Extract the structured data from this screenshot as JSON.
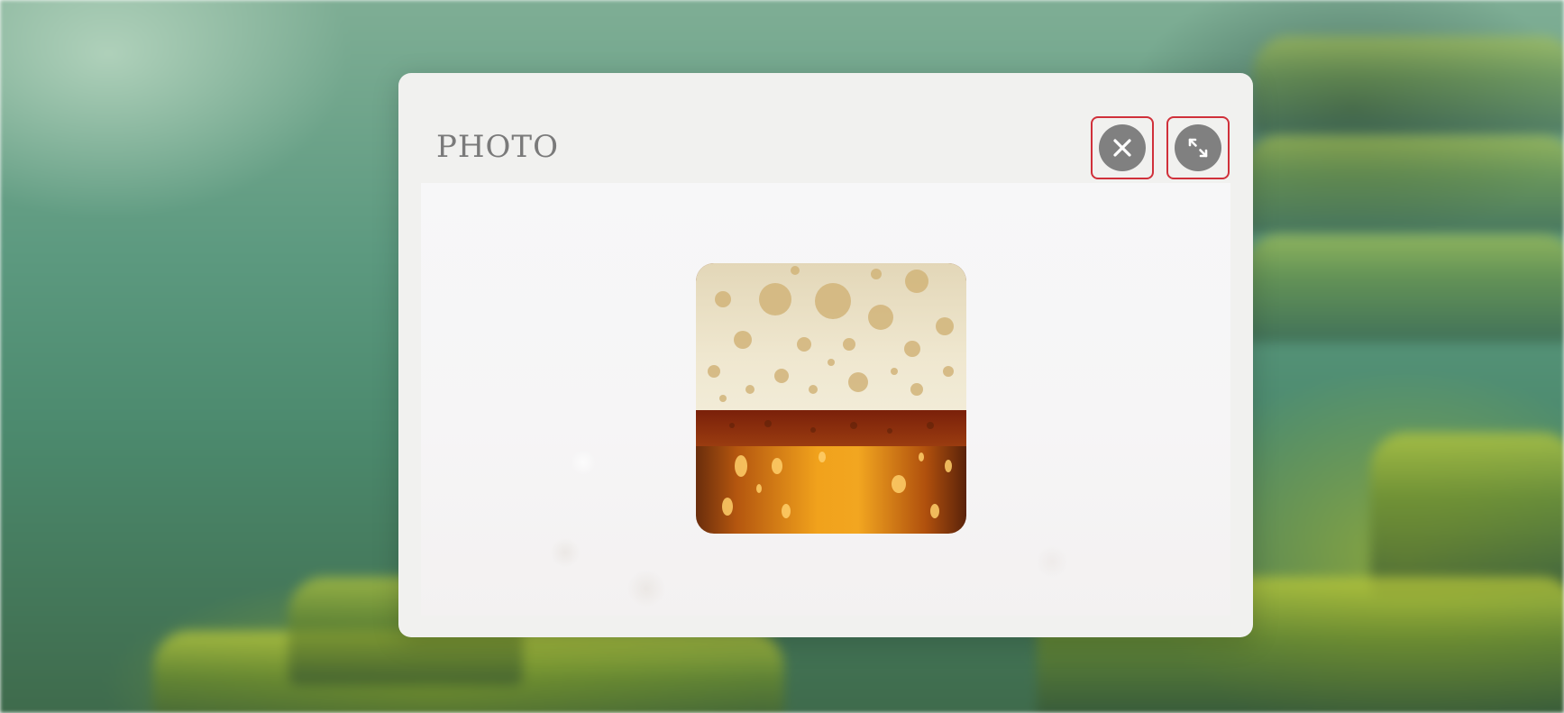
{
  "modal": {
    "title": "PHOTO"
  },
  "buttons": {
    "close_icon": "close-icon",
    "expand_icon": "expand-icon"
  },
  "photo": {
    "subject": "beer-glass-foam-image"
  },
  "colors": {
    "modal_bg": "#f1f1ef",
    "title_text": "#7a7a7a",
    "icon_circle": "#808080",
    "button_outline": "#d0303a",
    "beer_amber": "#d9820f",
    "foam": "#efe6cc"
  }
}
